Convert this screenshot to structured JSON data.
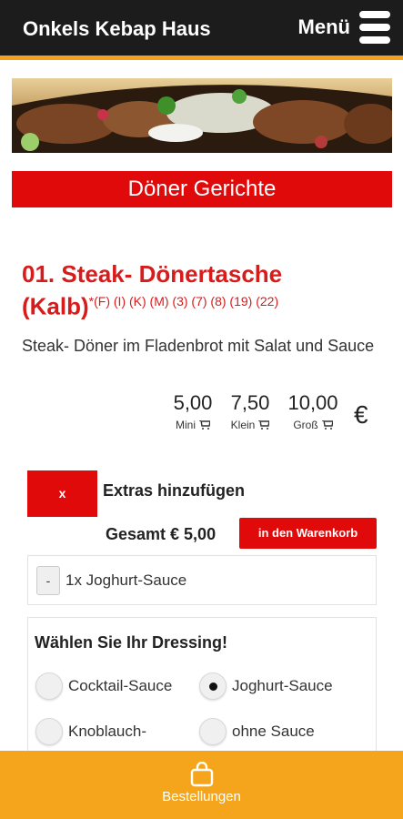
{
  "header": {
    "title": "Onkels Kebap Haus",
    "menu_label": "Menü"
  },
  "category": {
    "title": "Döner Gerichte"
  },
  "item": {
    "title_line1": "01. Steak- Dönertasche",
    "title_line2": "(Kalb)",
    "allergens": "*(F) (I) (K) (M) (3) (7) (8) (19) (22)",
    "description": "Steak- Döner im Fladenbrot mit Salat und Sauce",
    "prices": [
      {
        "value": "5,00",
        "size": "Mini"
      },
      {
        "value": "7,50",
        "size": "Klein"
      },
      {
        "value": "10,00",
        "size": "Groß"
      }
    ],
    "currency": "€"
  },
  "extras": {
    "toggle_label": "x",
    "label": "Extras hinzufügen",
    "total": "Gesamt € 5,00",
    "cart_button": "in den Warenkorb",
    "selected": [
      {
        "remove_label": "-",
        "text": "1x Joghurt-Sauce"
      }
    ]
  },
  "dressing": {
    "title": "Wählen Sie Ihr Dressing!",
    "options": [
      {
        "label": "Cocktail-Sauce",
        "checked": false
      },
      {
        "label": "Joghurt-Sauce",
        "checked": true
      },
      {
        "label": "Knoblauch-",
        "checked": false
      },
      {
        "label": "ohne Sauce",
        "checked": false
      }
    ]
  },
  "footer": {
    "orders_label": "Bestellungen"
  },
  "colors": {
    "header_bg": "#1c1c1c",
    "accent_orange": "#f5a51c",
    "red": "#e10a0a"
  }
}
